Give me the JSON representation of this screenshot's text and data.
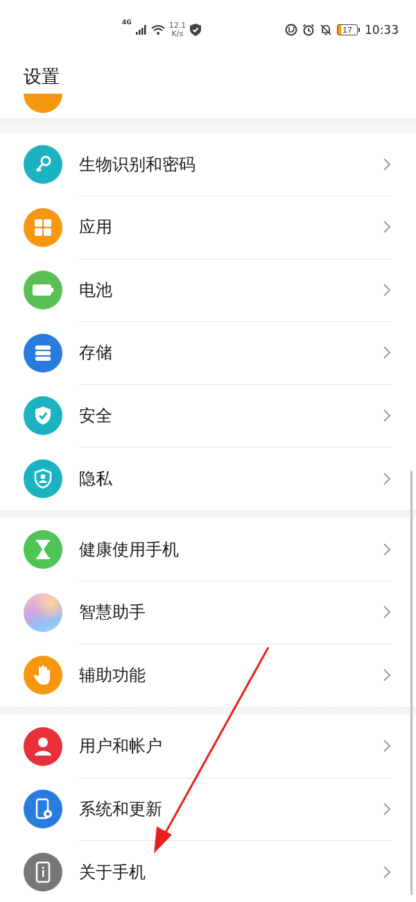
{
  "status_bar": {
    "network": "4G",
    "speed_value": "12.1",
    "speed_unit": "K/s",
    "battery": "17",
    "time": "10:33"
  },
  "title": "设置",
  "groups": [
    {
      "items": [
        {
          "label": "生物识别和密码",
          "kind": "key",
          "color": "#1bb3c2"
        },
        {
          "label": "应用",
          "kind": "apps",
          "color": "#f7960f"
        },
        {
          "label": "电池",
          "kind": "battery",
          "color": "#5cbf56"
        },
        {
          "label": "存储",
          "kind": "storage",
          "color": "#2a7be0"
        },
        {
          "label": "安全",
          "kind": "shield",
          "color": "#1bb3c2"
        },
        {
          "label": "隐私",
          "kind": "privacy",
          "color": "#1bb3c2"
        }
      ]
    },
    {
      "items": [
        {
          "label": "健康使用手机",
          "kind": "hourglass",
          "color": "#4fc555"
        },
        {
          "label": "智慧助手",
          "kind": "orb",
          "color": "#c9a4e8"
        },
        {
          "label": "辅助功能",
          "kind": "hand",
          "color": "#f7960f"
        }
      ]
    },
    {
      "items": [
        {
          "label": "用户和帐户",
          "kind": "user",
          "color": "#e8303c"
        },
        {
          "label": "系统和更新",
          "kind": "system",
          "color": "#2a7be0"
        },
        {
          "label": "关于手机",
          "kind": "about",
          "color": "#777777"
        }
      ]
    }
  ]
}
